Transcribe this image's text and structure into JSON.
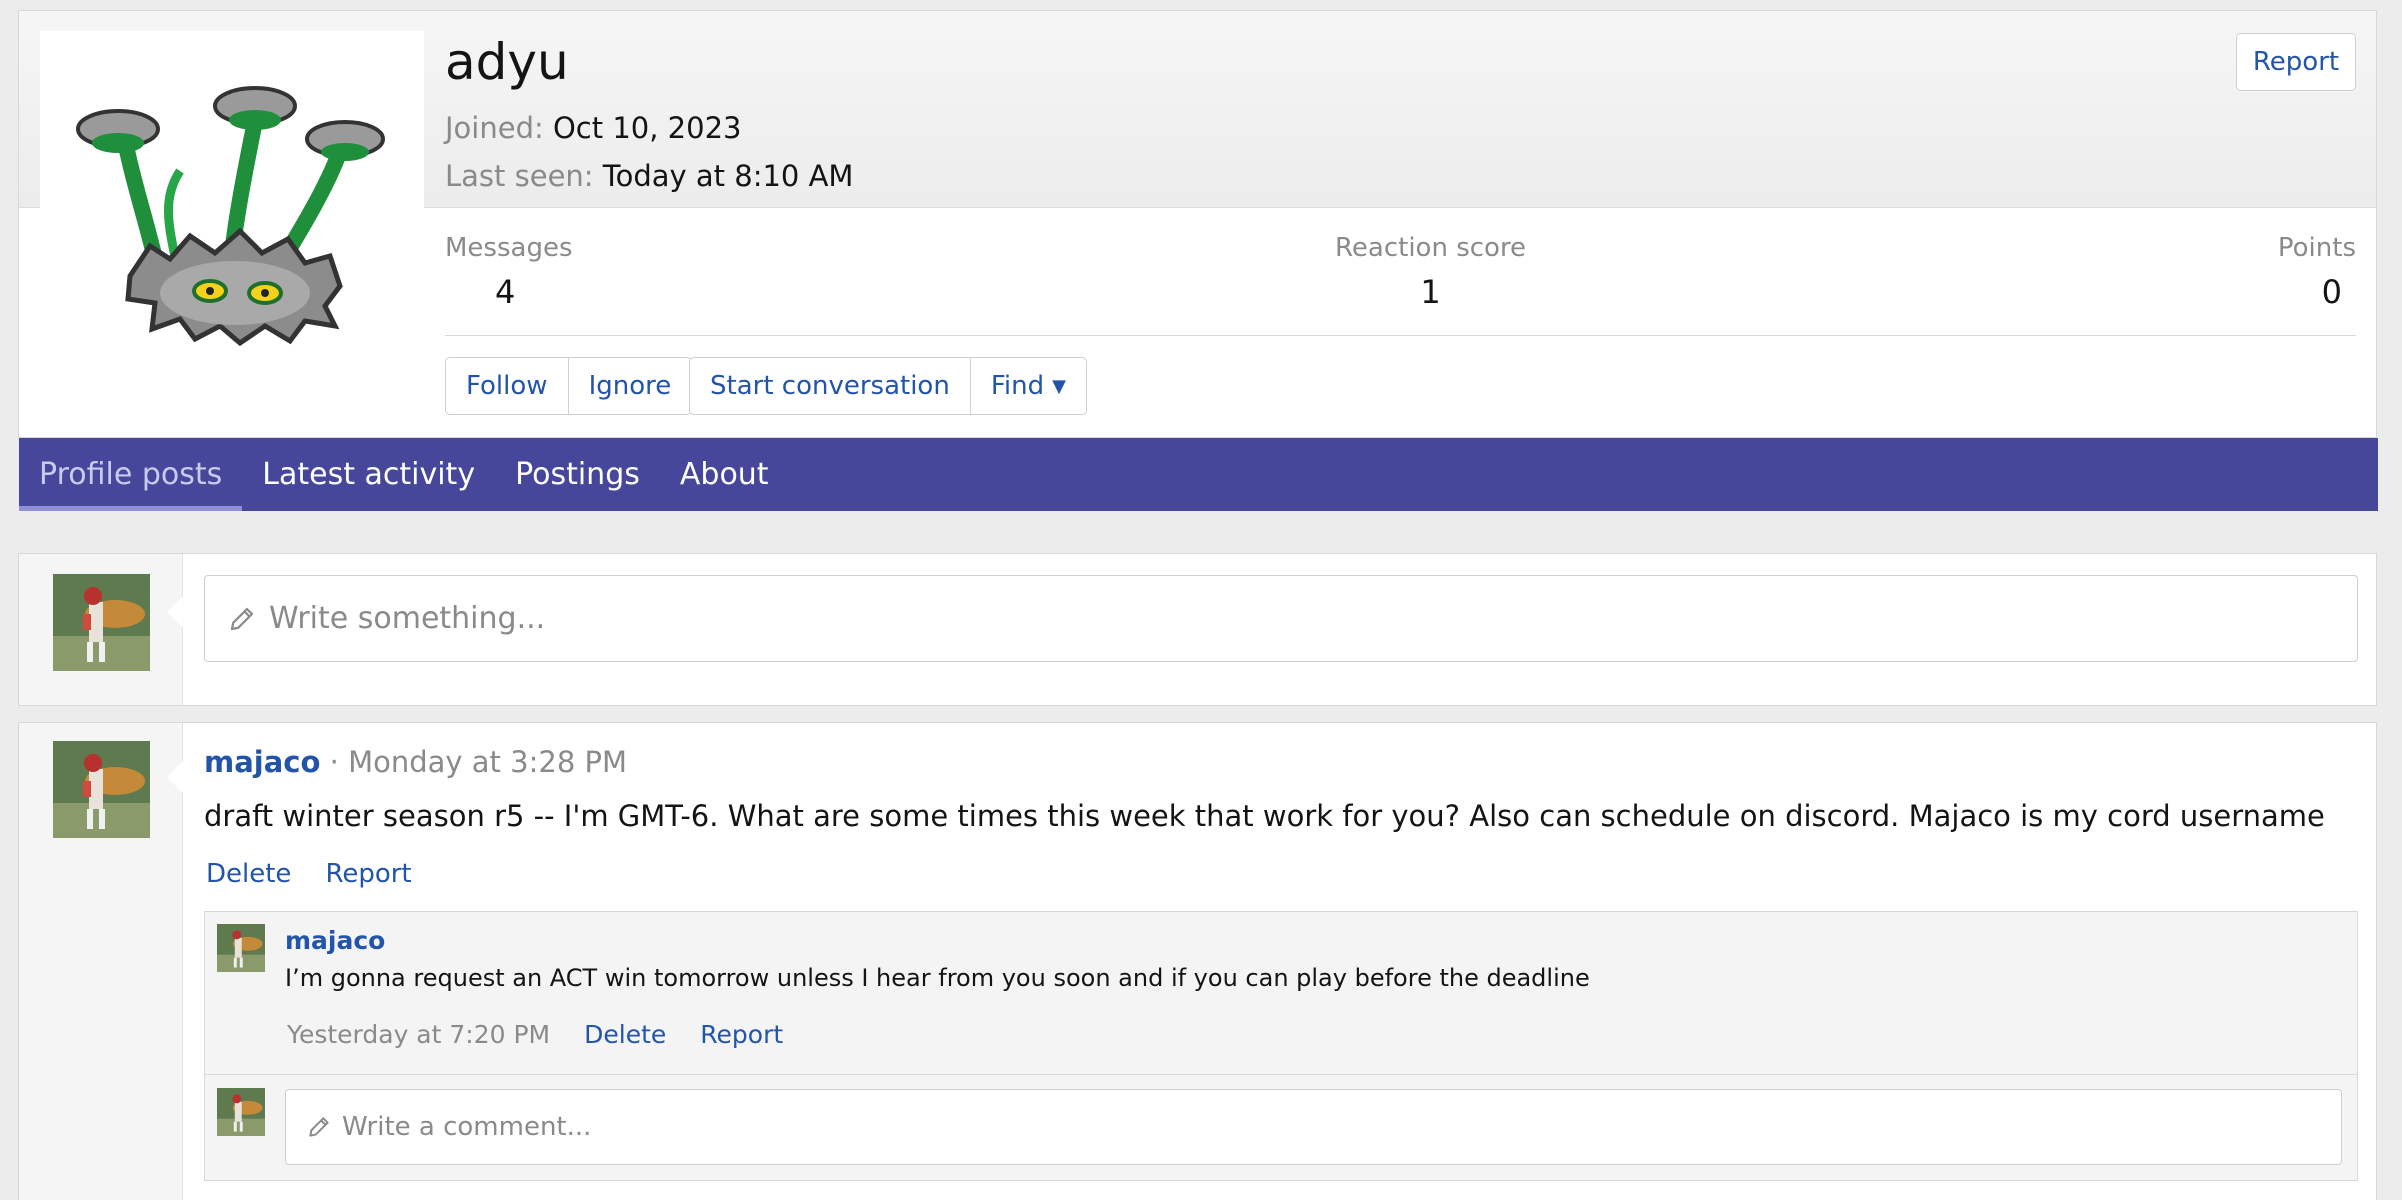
{
  "profile": {
    "username": "adyu",
    "joined_label": "Joined:",
    "joined_value": "Oct 10, 2023",
    "last_seen_label": "Last seen:",
    "last_seen_value": "Today at 8:10 AM",
    "report_label": "Report",
    "stats": [
      {
        "label": "Messages",
        "value": "4"
      },
      {
        "label": "Reaction score",
        "value": "1"
      },
      {
        "label": "Points",
        "value": "0"
      }
    ],
    "buttons": {
      "follow": "Follow",
      "ignore": "Ignore",
      "start_conversation": "Start conversation",
      "find": "Find"
    }
  },
  "tabs": [
    {
      "label": "Profile posts",
      "active": true
    },
    {
      "label": "Latest activity",
      "active": false
    },
    {
      "label": "Postings",
      "active": false
    },
    {
      "label": "About",
      "active": false
    }
  ],
  "composer": {
    "placeholder": "Write something..."
  },
  "post": {
    "author": "majaco",
    "separator": "·",
    "time": "Monday at 3:28 PM",
    "body": "draft winter season r5 -- I'm GMT-6. What are some times this week that work for you? Also can schedule on discord. Majaco is my cord username",
    "delete_label": "Delete",
    "report_label": "Report",
    "comment": {
      "author": "majaco",
      "text": "I’m gonna request an ACT win tomorrow unless I hear from you soon and if you can play before the deadline",
      "time": "Yesterday at 7:20 PM",
      "delete_label": "Delete",
      "report_label": "Report"
    },
    "comment_placeholder": "Write a comment..."
  },
  "colors": {
    "accent": "#2255aa",
    "tab_bar": "#46479a",
    "muted": "#8a8a8a"
  }
}
